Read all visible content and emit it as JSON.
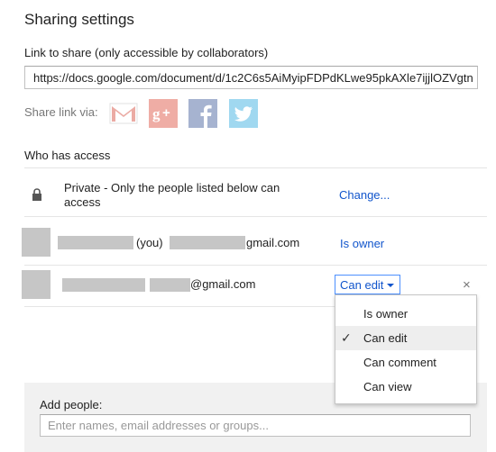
{
  "dialog": {
    "title": "Sharing settings",
    "link_label": "Link to share (only accessible by collaborators)",
    "link_url": "https://docs.google.com/document/d/1c2C6s5AiMyipFDPdKLwe95pkAXle7ijjlOZVgtn",
    "share_via_label": "Share link via:",
    "share_icons": [
      {
        "name": "gmail-icon",
        "color": "#d44638"
      },
      {
        "name": "google-plus-icon",
        "color": "#dd4b39"
      },
      {
        "name": "facebook-icon",
        "color": "#3b5998"
      },
      {
        "name": "twitter-icon",
        "color": "#2fa9e0"
      }
    ]
  },
  "access": {
    "heading": "Who has access",
    "visibility": {
      "text": "Private - Only the people listed below can access",
      "change_label": "Change...",
      "icon": "lock-icon"
    },
    "owner_row": {
      "you_label": "(you)",
      "email_suffix": "gmail.com",
      "role": "Is owner"
    },
    "collaborator_row": {
      "email_suffix": "@gmail.com",
      "role": "Can edit",
      "remove_label": "×"
    }
  },
  "role_menu": {
    "selected": "Can edit",
    "options": [
      "Is owner",
      "Can edit",
      "Can comment",
      "Can view"
    ],
    "check_glyph": "✓"
  },
  "add_people": {
    "label": "Add people:",
    "placeholder": "Enter names, email addresses or groups..."
  },
  "colors": {
    "link": "#1155cc",
    "panel": "#f1f1f1",
    "focus_border": "#4d90fe",
    "redaction": "#c6c6c6"
  }
}
